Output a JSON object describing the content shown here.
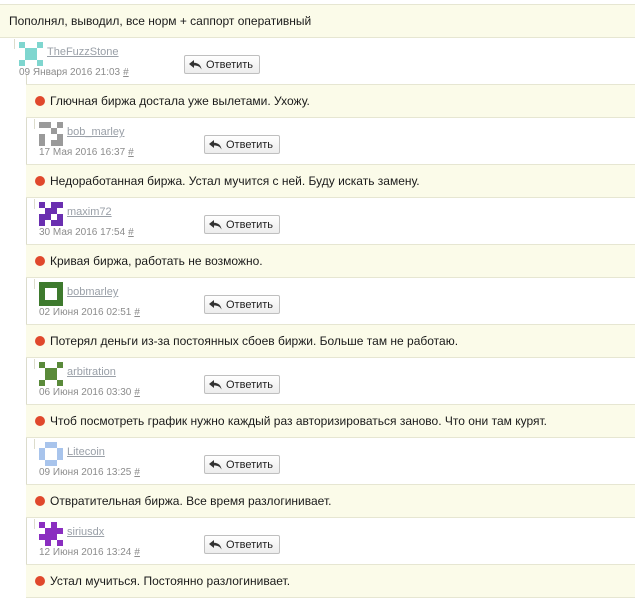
{
  "accent_dot_color": "#e0482c",
  "reply_icon": "reply-arrow-icon",
  "top_comment": {
    "text": "Пополнял, выводил, все норм + саппорт оперативный"
  },
  "top_meta": {
    "author": "TheFuzzStone",
    "date": "09 Января 2016 21:03",
    "hash": "#",
    "reply_label": "Ответить"
  },
  "replies": [
    {
      "text": "Глючная биржа достала уже вылетами. Ухожу.",
      "author": "bob_marley",
      "date": "17 Мая 2016 16:37",
      "hash": "#",
      "reply_label": "Ответить"
    },
    {
      "text": "Недоработанная биржа. Устал мучится с ней. Буду искать замену.",
      "author": "maxim72",
      "date": "30 Мая 2016 17:54",
      "hash": "#",
      "reply_label": "Ответить"
    },
    {
      "text": "Кривая биржа, работать не возможно.",
      "author": "bobmarley",
      "date": "02 Июня 2016 02:51",
      "hash": "#",
      "reply_label": "Ответить"
    },
    {
      "text": "Потерял деньги из-за постоянных сбоев биржи. Больше там не работаю.",
      "author": "arbitration",
      "date": "06 Июня 2016 03:30",
      "hash": "#",
      "reply_label": "Ответить"
    },
    {
      "text": "Чтоб посмотреть график нужно каждый раз авторизироваться заново. Что они там курят.",
      "author": "Litecoin",
      "date": "09 Июня 2016 13:25",
      "hash": "#",
      "reply_label": "Ответить"
    },
    {
      "text": "Отвратительная биржа. Все время разлогинивает.",
      "author": "siriusdx",
      "date": "12 Июня 2016 13:24",
      "hash": "#",
      "reply_label": "Ответить"
    },
    {
      "text": "Устал мучиться. Постоянно разлогинивает."
    }
  ]
}
